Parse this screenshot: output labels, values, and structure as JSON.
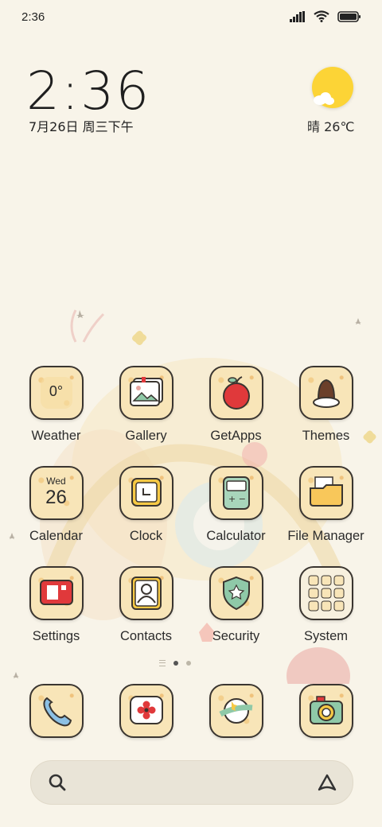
{
  "status": {
    "time": "2:36"
  },
  "clock_widget": {
    "time": "2:36",
    "date": "7月26日 周三下午"
  },
  "weather_widget": {
    "condition_temp": "晴 26℃"
  },
  "apps_row1": [
    {
      "label": "Weather",
      "icon": "weather-icon",
      "value": "0°"
    },
    {
      "label": "Gallery",
      "icon": "gallery-icon"
    },
    {
      "label": "GetApps",
      "icon": "apple-icon"
    },
    {
      "label": "Themes",
      "icon": "themes-icon"
    }
  ],
  "apps_row2": [
    {
      "label": "Calendar",
      "icon": "calendar-icon",
      "weekday": "Wed",
      "day": "26"
    },
    {
      "label": "Clock",
      "icon": "clock-icon"
    },
    {
      "label": "Calculator",
      "icon": "calculator-icon"
    },
    {
      "label": "File Manager",
      "icon": "folder-icon"
    }
  ],
  "apps_row3": [
    {
      "label": "Settings",
      "icon": "settings-icon"
    },
    {
      "label": "Contacts",
      "icon": "contacts-icon"
    },
    {
      "label": "Security",
      "icon": "security-icon"
    },
    {
      "label": "System",
      "icon": "system-folder-icon"
    }
  ],
  "dock": [
    {
      "icon": "phone-icon"
    },
    {
      "icon": "messages-icon"
    },
    {
      "icon": "browser-icon"
    },
    {
      "icon": "camera-icon"
    }
  ],
  "pager": {
    "pages": 2,
    "active": 1
  },
  "colors": {
    "background": "#f8f4e9",
    "tile": "#f8e5b8",
    "sun": "#fcd436",
    "accent_red": "#e0393b",
    "accent_green": "#8fc9a8"
  }
}
